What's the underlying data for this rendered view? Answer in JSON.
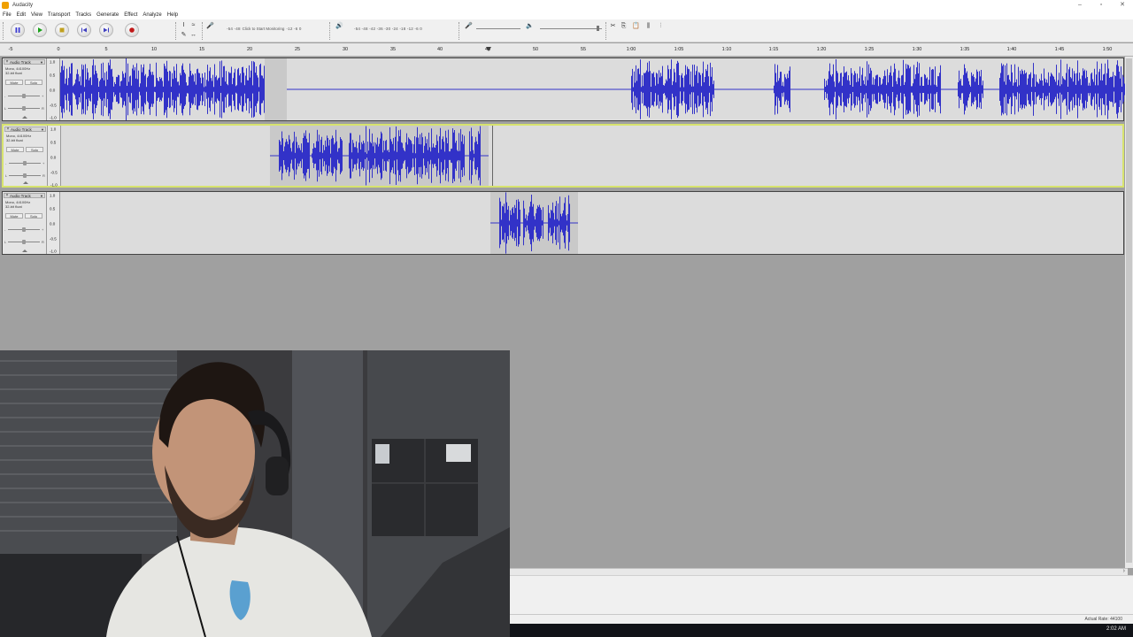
{
  "window": {
    "title": "Audacity",
    "min_label": "–",
    "max_label": "▫",
    "close_label": "✕"
  },
  "menu": [
    "File",
    "Edit",
    "View",
    "Transport",
    "Tracks",
    "Generate",
    "Effect",
    "Analyze",
    "Help"
  ],
  "toolbar": {
    "record_meter_scale": "-54  -48",
    "monitor_label": "Click to Start Monitoring",
    "record_meter_scale_right": "-12   -6    0",
    "playback_meter_scale": "-54  -48  -42  -36  -30  -24  -18  -12   -6    0"
  },
  "ruler": {
    "ticks": [
      "-5",
      "0",
      "5",
      "10",
      "15",
      "20",
      "25",
      "30",
      "35",
      "40",
      "45",
      "50",
      "55",
      "1:00",
      "1:05",
      "1:10",
      "1:15",
      "1:20",
      "1:25",
      "1:30",
      "1:35",
      "1:40",
      "1:45",
      "1:50"
    ]
  },
  "tracks": [
    {
      "name": "Audio Track",
      "info_line1": "Mono, 44100Hz",
      "info_line2": "32-bit float",
      "mute": "Mute",
      "solo": "Solo",
      "scale": [
        "1.0",
        "0.5",
        "0.0",
        "-0.5",
        "-1.0"
      ]
    },
    {
      "name": "Audio Track",
      "info_line1": "Mono, 44100Hz",
      "info_line2": "32-bit float",
      "mute": "Mute",
      "solo": "Solo",
      "scale": [
        "1.0",
        "0.5",
        "0.0",
        "-0.5",
        "-1.0"
      ]
    },
    {
      "name": "Audio Track",
      "info_line1": "Mono, 44100Hz",
      "info_line2": "32-bit float",
      "mute": "Mute",
      "solo": "Solo",
      "scale": [
        "1.0",
        "0.5",
        "0.0",
        "-0.5",
        "-1.0"
      ]
    }
  ],
  "track_control_labels": {
    "gain_minus": "-",
    "gain_plus": "+",
    "pan_left": "L",
    "pan_right": "R"
  },
  "status": {
    "actual_rate": "Actual Rate: 44100"
  },
  "taskbar": {
    "clock": "2:02 AM"
  },
  "colors": {
    "waveform": "#3232c8",
    "selected_track_border": "#d7e36e",
    "track_bg": "#dcdcdc",
    "clip_selected": "#c9c9c9"
  }
}
